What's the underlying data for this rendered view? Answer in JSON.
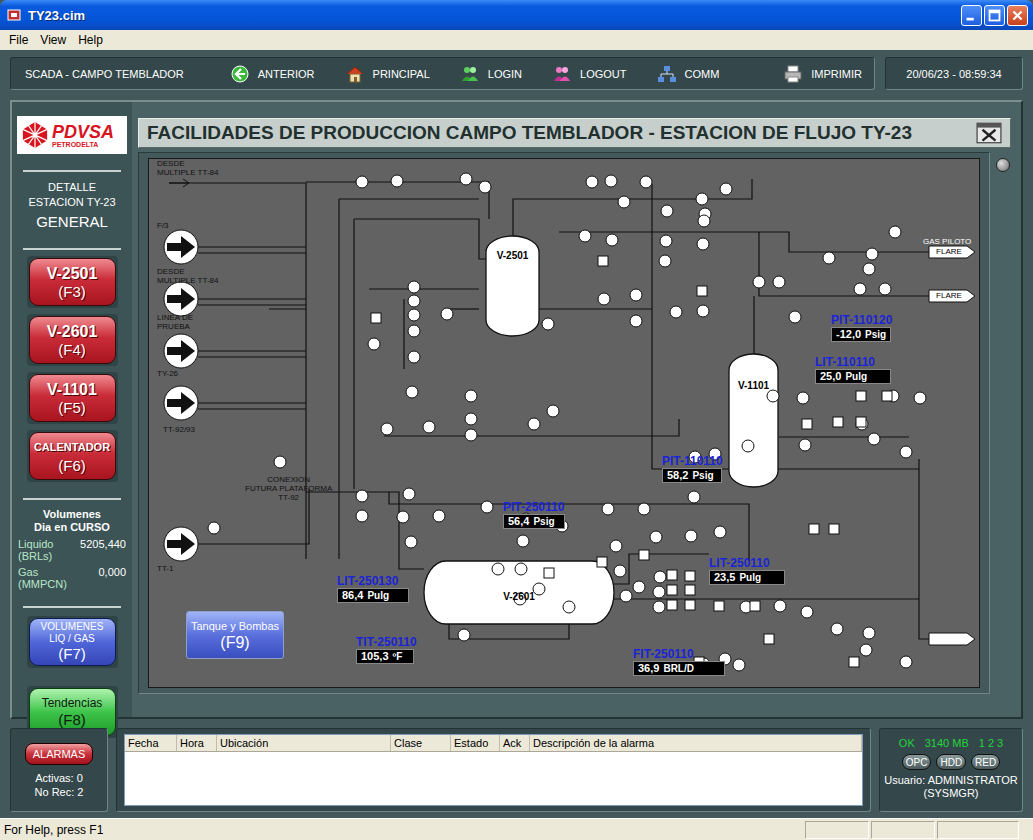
{
  "window": {
    "title": "TY23.cim"
  },
  "menu": [
    "File",
    "View",
    "Help"
  ],
  "toolbar": {
    "app_label": "SCADA - CAMPO TEMBLADOR",
    "buttons": [
      {
        "label": "ANTERIOR",
        "kind": "back"
      },
      {
        "label": "PRINCIPAL",
        "kind": "home"
      },
      {
        "label": "LOGIN",
        "kind": "login"
      },
      {
        "label": "LOGOUT",
        "kind": "logout"
      },
      {
        "label": "COMM",
        "kind": "comm"
      },
      {
        "label": "IMPRIMIR",
        "kind": "print"
      }
    ],
    "clock": "20/06/23 - 08:59:34"
  },
  "logo": {
    "name": "PDVSA",
    "sub": "PETRODELTA"
  },
  "sidebar": {
    "detail_lines": [
      "DETALLE",
      "ESTACION TY-23"
    ],
    "section": "GENERAL",
    "vessel_buttons": [
      {
        "label": "V-2501",
        "key": "(F3)",
        "kind": "large"
      },
      {
        "label": "V-2601",
        "key": "(F4)",
        "kind": "large"
      },
      {
        "label": "V-1101",
        "key": "(F5)",
        "kind": "large"
      },
      {
        "label": "CALENTADOR",
        "key": "(F6)",
        "kind": "small"
      }
    ],
    "volumes": {
      "title_lines": [
        "Volumenes",
        "Dia en CURSO"
      ],
      "rows": [
        {
          "label_lines": [
            "Liquido",
            "(BRLs)"
          ],
          "value": "5205,440"
        },
        {
          "label_lines": [
            "Gas",
            "(MMPCN)"
          ],
          "value": "0,000"
        }
      ]
    },
    "volume_button": {
      "label_lines": [
        "VOLUMENES",
        "LIQ / GAS"
      ],
      "key": "(F7)"
    },
    "trend_button": {
      "label": "Tendencias",
      "key": "(F8)"
    }
  },
  "page_title": "FACILIDADES DE PRODUCCION CAMPO TEMBLADOR - ESTACION DE FLUJO TY-23",
  "diagram": {
    "vessels": [
      {
        "name": "V-2501",
        "kind": "vertical"
      },
      {
        "name": "V-1101",
        "kind": "vertical"
      },
      {
        "name": "V-2601",
        "kind": "horizontal"
      }
    ],
    "inlets": [
      {
        "label_lines": [
          "DESDE",
          "MULTIPLE TT-84"
        ],
        "kind": "line"
      },
      {
        "label_lines": [
          "F/3"
        ],
        "kind": "circle"
      },
      {
        "label_lines": [
          "DESDE",
          "MULTIPLE TT-84"
        ],
        "kind": "circle"
      },
      {
        "label_lines": [
          "LINEA DE",
          "PRUEBA"
        ],
        "kind": "circle"
      },
      {
        "label_lines": [
          "TY-26"
        ],
        "kind": "circle"
      },
      {
        "label_lines": [
          "TT-1"
        ],
        "kind": "circle"
      }
    ],
    "notes": [
      {
        "lines": [
          "TT-92/93"
        ]
      },
      {
        "lines": [
          "CONEXION",
          "FUTURA PLATAFORMA",
          "TT-92"
        ]
      }
    ],
    "outlets": [
      {
        "label": "FLARE",
        "note": "GAS PILOTO"
      },
      {
        "label": "FLARE",
        "note": ""
      }
    ],
    "instruments": [
      {
        "tag": "PIT-110120",
        "value": "-12,0",
        "unit": "Psig"
      },
      {
        "tag": "LIT-110110",
        "value": "25,0",
        "unit": "Pulg"
      },
      {
        "tag": "PIT-110110",
        "value": "58,2",
        "unit": "Psig"
      },
      {
        "tag": "PIT-250110",
        "value": "56,4",
        "unit": "Psig"
      },
      {
        "tag": "LIT-250110",
        "value": "23,5",
        "unit": "Pulg"
      },
      {
        "tag": "LIT-250130",
        "value": "86,4",
        "unit": "Pulg"
      },
      {
        "tag": "TIT-250110",
        "value": "105,3",
        "unit": "ºF"
      },
      {
        "tag": "FIT-250110",
        "value": "36,9",
        "unit": "BRL/D"
      }
    ],
    "tank_button": {
      "label": "Tanque y Bombas",
      "key": "(F9)"
    }
  },
  "alarms": {
    "button": "ALARMAS",
    "active": "Activas: 0",
    "unacked": "No Rec: 2",
    "columns": [
      "Fecha",
      "Hora",
      "Ubicación",
      "Clase",
      "Estado",
      "Ack",
      "Descripción de la alarma"
    ],
    "rows": []
  },
  "system": {
    "status": "OK",
    "memory": "3140 MB",
    "channels": [
      "1",
      "2",
      "3"
    ],
    "buttons": [
      "OPC",
      "HDD",
      "RED"
    ],
    "user_lines": [
      "Usuario: ADMINISTRATOR",
      "(SYSMGR)"
    ]
  },
  "status_bar": "For Help, press F1"
}
